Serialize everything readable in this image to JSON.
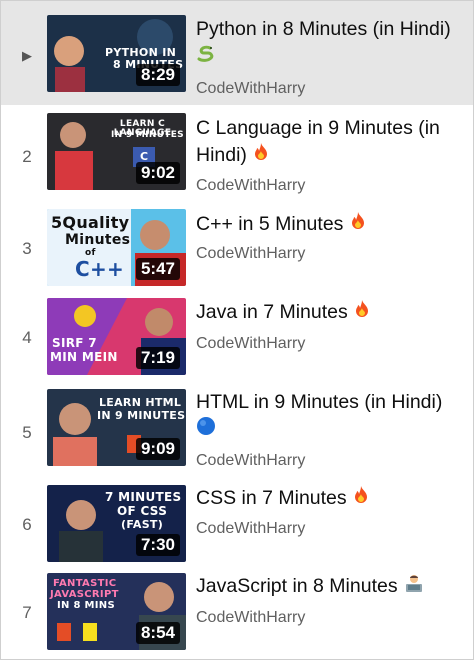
{
  "playlist": {
    "items": [
      {
        "index": "",
        "active": true,
        "title": "Python in 8 Minutes (in Hindi)",
        "emoji": "snake-icon",
        "channel": "CodeWithHarry",
        "duration": "8:29",
        "thumb_text": [
          "PYTHON IN",
          "8 MINUTES"
        ],
        "thumb_color": "#1c3048"
      },
      {
        "index": "2",
        "active": false,
        "title": "C Language in 9 Minutes (in Hindi)",
        "emoji": "fire-icon",
        "channel": "CodeWithHarry",
        "duration": "9:02",
        "thumb_text": [
          "LEARN C LANGUAGE",
          "IN 9 MINUTES"
        ],
        "thumb_color": "#2a2a2e"
      },
      {
        "index": "3",
        "active": false,
        "title": "C++ in 5 Minutes",
        "emoji": "fire-icon",
        "channel": "CodeWithHarry",
        "duration": "5:47",
        "thumb_text": [
          "5Quality",
          "Minutes",
          "of",
          "C++"
        ],
        "thumb_color": "#5bc0e8"
      },
      {
        "index": "4",
        "active": false,
        "title": "Java in 7 Minutes",
        "emoji": "fire-icon",
        "channel": "CodeWithHarry",
        "duration": "7:19",
        "thumb_text": [
          "SIRF 7",
          "MIN MEIN"
        ],
        "thumb_color": "#d8386e"
      },
      {
        "index": "5",
        "active": false,
        "title": "HTML in 9 Minutes (in Hindi)",
        "emoji": "blue-circle-icon",
        "channel": "CodeWithHarry",
        "duration": "9:09",
        "thumb_text": [
          "LEARN HTML",
          "IN 9 MINUTES"
        ],
        "thumb_color": "#24344a"
      },
      {
        "index": "6",
        "active": false,
        "title": "CSS in 7 Minutes",
        "emoji": "fire-icon",
        "channel": "CodeWithHarry",
        "duration": "7:30",
        "thumb_text": [
          "7 MINUTES",
          "OF CSS",
          "(FAST)"
        ],
        "thumb_color": "#14224a"
      },
      {
        "index": "7",
        "active": false,
        "title": "JavaScript in 8 Minutes",
        "emoji": "technologist-icon",
        "channel": "CodeWithHarry",
        "duration": "8:54",
        "thumb_text": [
          "FANTASTIC",
          "JAVASCRIPT",
          "IN 8 MINS"
        ],
        "thumb_color": "#24305a"
      }
    ]
  }
}
